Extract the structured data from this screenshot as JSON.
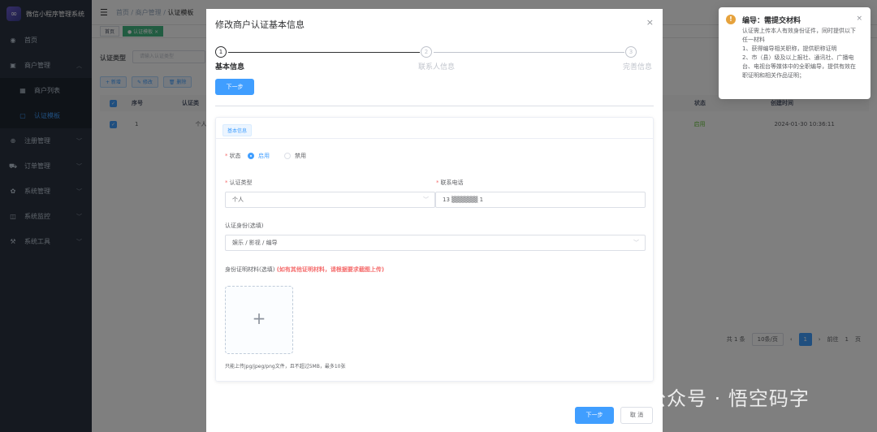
{
  "app": {
    "title": "微信小程序管理系统"
  },
  "sidebar": {
    "items": [
      {
        "label": "首页",
        "icon": "dashboard-icon"
      },
      {
        "label": "商户管理",
        "icon": "shop-icon"
      },
      {
        "label": "商户列表",
        "icon": "grid-icon"
      },
      {
        "label": "认证模板",
        "icon": "document-icon"
      },
      {
        "label": "注册管理",
        "icon": "plus-circle-icon"
      },
      {
        "label": "订单管理",
        "icon": "cart-icon"
      },
      {
        "label": "系统管理",
        "icon": "gear-icon"
      },
      {
        "label": "系统监控",
        "icon": "monitor-icon"
      },
      {
        "label": "系统工具",
        "icon": "tool-icon"
      }
    ]
  },
  "header": {
    "breadcrumb": [
      "首页",
      "商户管理",
      "认证模板"
    ]
  },
  "tags": [
    "首页",
    "● 认证模板 ×"
  ],
  "filter": {
    "label": "认证类型",
    "placeholder": "请输入认证类型"
  },
  "toolbar": {
    "add": "+ 新增",
    "edit": "✎ 修改",
    "delete": "🗑 删除"
  },
  "table": {
    "headers": [
      "序号",
      "认证类",
      "状态",
      "创建时间"
    ],
    "rows": [
      {
        "index": "1",
        "type": "个人",
        "status": "启用",
        "created": "2024-01-30 10:36:11"
      }
    ]
  },
  "pagination": {
    "total": "共 1 条",
    "size": "10条/页",
    "current": "1",
    "goto": "前往",
    "goto_page": "1",
    "unit": "页"
  },
  "dialog": {
    "title": "修改商户认证基本信息",
    "close": "×",
    "steps": [
      {
        "num": "1",
        "label": "基本信息"
      },
      {
        "num": "2",
        "label": "联系人信息"
      },
      {
        "num": "3",
        "label": "完善信息"
      }
    ],
    "next_top": "下一步",
    "card_tag": "基本信息",
    "status_label": "状态",
    "status_options": [
      "启用",
      "禁用"
    ],
    "type_label": "认证类型",
    "type_value": "个人",
    "phone_label": "联系电话",
    "phone_value": "13 ▒▒▒▒▒▒ 1",
    "identity_label": "认证身份(选填)",
    "identity_value": "娱乐 / 影视 / 编导",
    "material_label": "身份证明材料(选填)",
    "material_hint": "(如有其他证明材料，请根据要求截图上传)",
    "upload_plus": "+",
    "upload_tip": "只能上传jpg/jpeg/png文件，且不超过5MB，最多10张",
    "next": "下一步",
    "cancel": "取 消"
  },
  "notification": {
    "title": "编导：需提交材料",
    "body": "认证需上传本人有效身份证件，同时提供以下任一材料\n1、获得编导相关职称，提供职称证明\n2、市（县）级及以上报社、通讯社、广播电台、电视台等媒体中的全职编导，提供有效在职证明和相关作品证明；"
  },
  "watermark": {
    "text": "公众号 · 悟空码字"
  },
  "colors": {
    "primary": "#409eff",
    "sidebar": "#2b3340",
    "danger": "#f56c6c",
    "warning": "#e6a23c",
    "success": "#67c23a"
  }
}
